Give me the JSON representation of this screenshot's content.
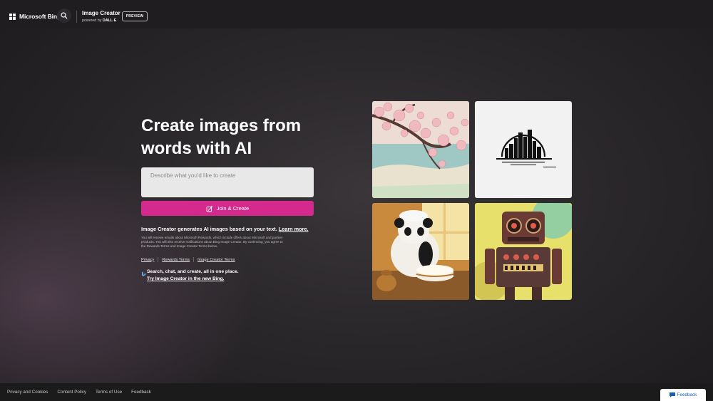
{
  "header": {
    "brand": "Microsoft Bing",
    "app_title": "Image Creator",
    "powered_prefix": "powered by",
    "powered_brand": "DALL·E",
    "badge": "PREVIEW"
  },
  "hero": {
    "headline_line1": "Create images from",
    "headline_line2": "words with AI",
    "prompt_placeholder": "Describe what you'd like to create",
    "create_button": "Join & Create",
    "info_text": "Image Creator generates AI images based on your text.",
    "learn_more": "Learn more.",
    "fine_print": "You will receive emails about Microsoft Rewards, which include offers about Microsoft and partner products. You will also receive notifications about Bing Image Creator. By continuing, you agree to the Rewards Terms and Image Creator Terms below.",
    "links": [
      "Privacy",
      "Rewards Terms",
      "Image Creator Terms"
    ],
    "promo_line1": "Search, chat, and create, all in one place.",
    "promo_line2": "Try Image Creator in the new Bing."
  },
  "footer": {
    "links": [
      "Privacy and Cookies",
      "Content Policy",
      "Terms of Use",
      "Feedback"
    ],
    "feedback_button": "Feedback"
  },
  "colors": {
    "accent": "#d42a8d",
    "header_bg": "#1f1d20",
    "footer_bg": "#1b1b1b"
  }
}
